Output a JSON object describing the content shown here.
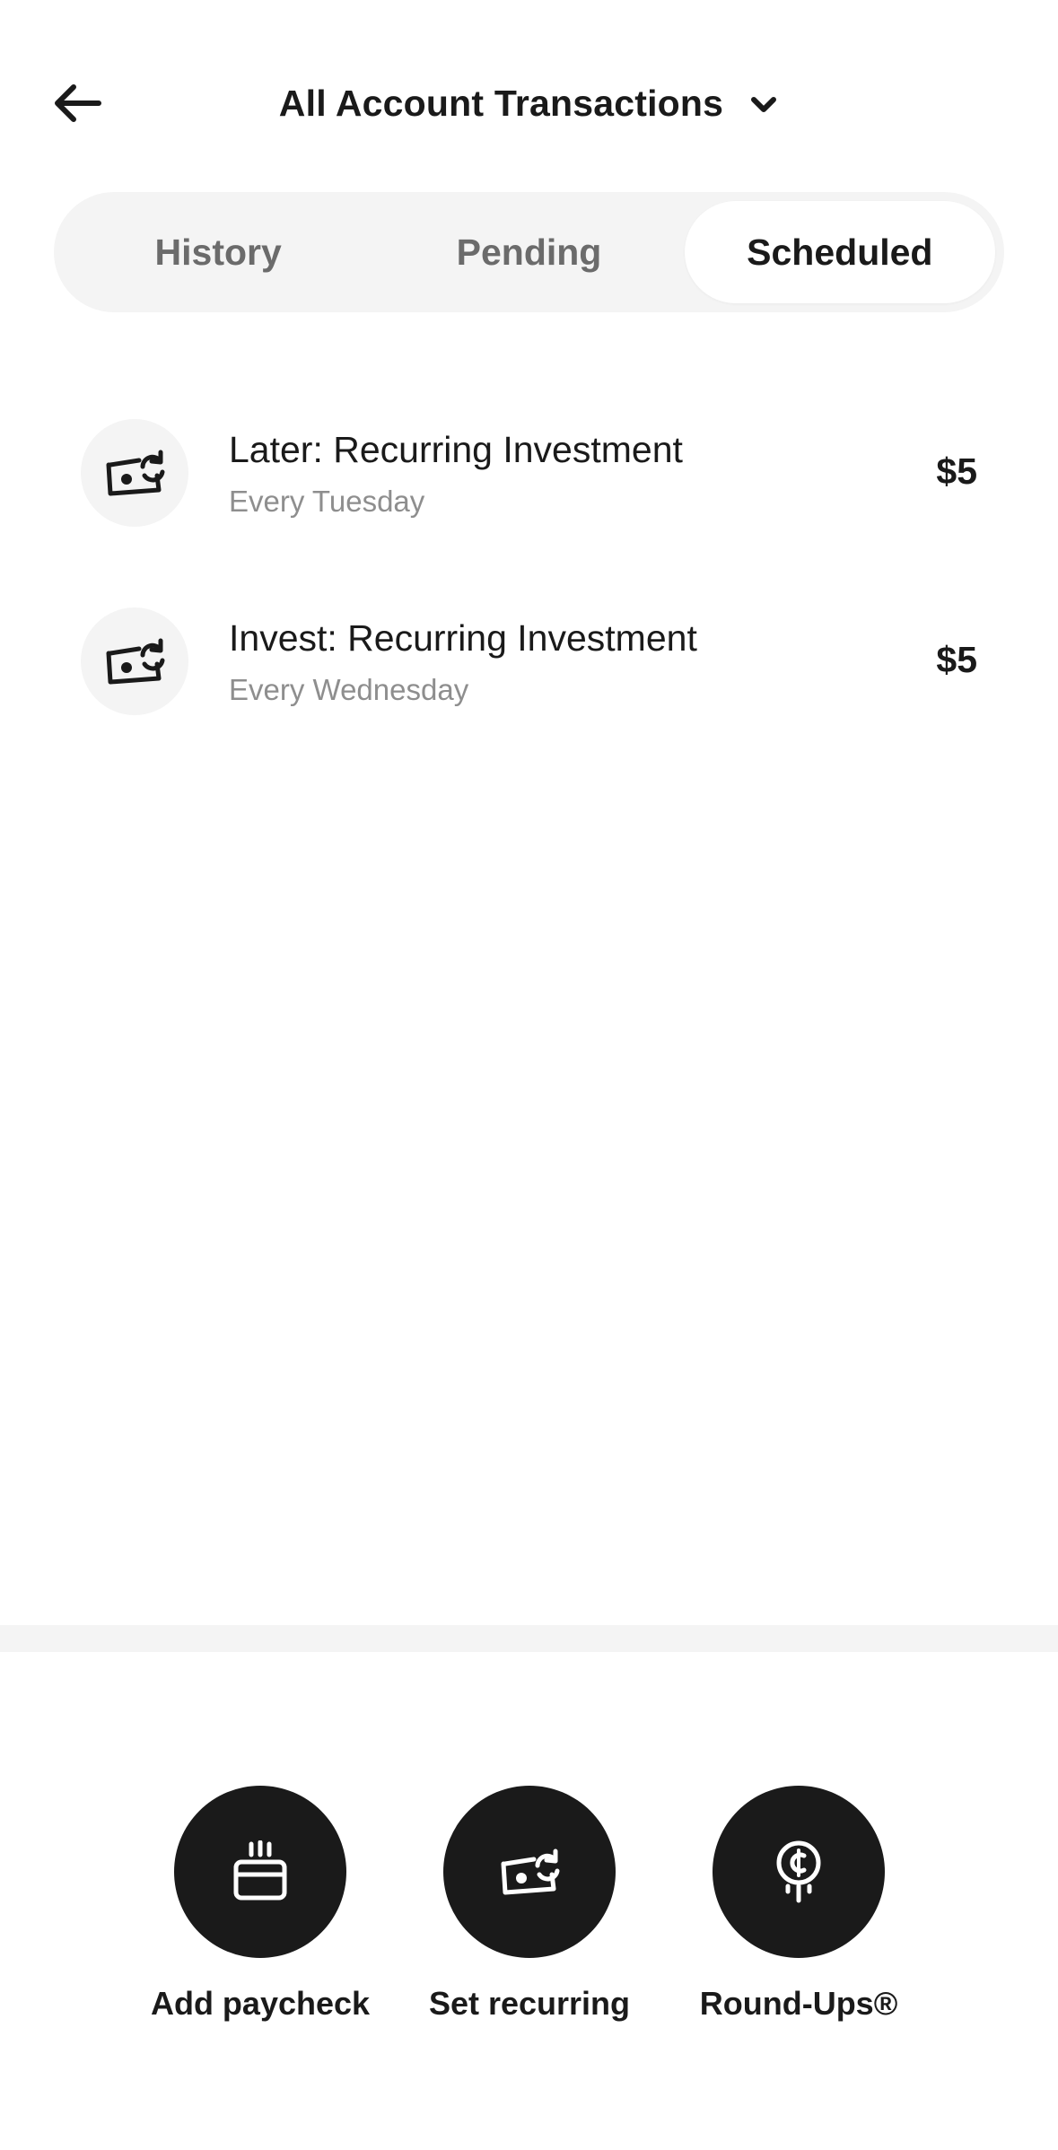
{
  "header": {
    "back_icon": "arrow-left-icon",
    "title": "All Account Transactions",
    "dropdown_icon": "chevron-down-icon"
  },
  "tabs": [
    {
      "label": "History",
      "active": false
    },
    {
      "label": "Pending",
      "active": false
    },
    {
      "label": "Scheduled",
      "active": true
    }
  ],
  "transactions": [
    {
      "icon": "recurring-money-icon",
      "title": "Later: Recurring Investment",
      "subtitle": "Every Tuesday",
      "amount": "$5"
    },
    {
      "icon": "recurring-money-icon",
      "title": "Invest: Recurring Investment",
      "subtitle": "Every Wednesday",
      "amount": "$5"
    }
  ],
  "actions": [
    {
      "icon": "paycheck-icon",
      "label": "Add paycheck"
    },
    {
      "icon": "recurring-money-icon",
      "label": "Set recurring"
    },
    {
      "icon": "round-ups-coin-icon",
      "label": "Round-Ups®"
    }
  ],
  "colors": {
    "text": "#1a1a1a",
    "muted": "#8e8e8e",
    "surface": "#f4f4f4",
    "background": "#ffffff"
  }
}
